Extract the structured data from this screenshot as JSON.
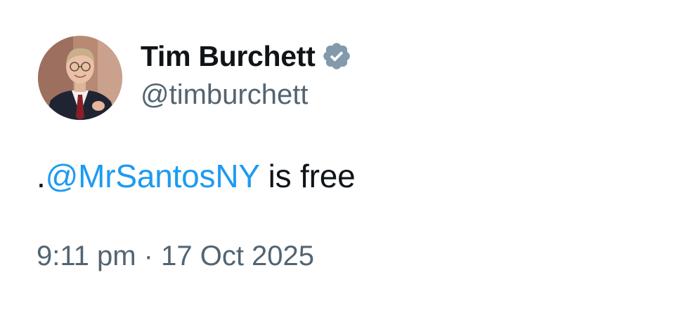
{
  "author": {
    "display_name": "Tim Burchett",
    "handle": "@timburchett",
    "avatar_icon": "profile-photo",
    "verified_icon": "verified-badge-icon",
    "verified_color": "#829aab"
  },
  "tweet": {
    "text_prefix": ".",
    "mention": "@MrSantosNY",
    "text_suffix": " is free",
    "mention_color": "#1d9bf0"
  },
  "meta": {
    "time": "9:11 pm",
    "separator": " · ",
    "date": "17 Oct 2025"
  }
}
